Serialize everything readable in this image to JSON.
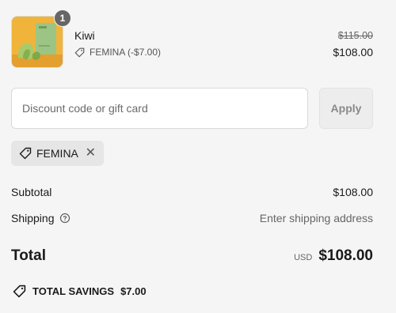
{
  "product": {
    "quantity": "1",
    "name": "Kiwi",
    "discount_label": "FEMINA (-$7.00)",
    "original_price": "$115.00",
    "price": "$108.00",
    "image_name": "kiwi-product-image"
  },
  "discount": {
    "placeholder": "Discount code or gift card",
    "apply_label": "Apply"
  },
  "applied_code": {
    "code": "FEMINA"
  },
  "summary": {
    "subtotal_label": "Subtotal",
    "subtotal_value": "$108.00",
    "shipping_label": "Shipping",
    "shipping_value": "Enter shipping address",
    "total_label": "Total",
    "currency": "USD",
    "total_value": "$108.00",
    "savings_label": "TOTAL SAVINGS",
    "savings_value": "$7.00"
  },
  "colors": {
    "background": "#f5f5f5",
    "product_bg": "#f0b43a",
    "product_box": "#9cc585"
  }
}
